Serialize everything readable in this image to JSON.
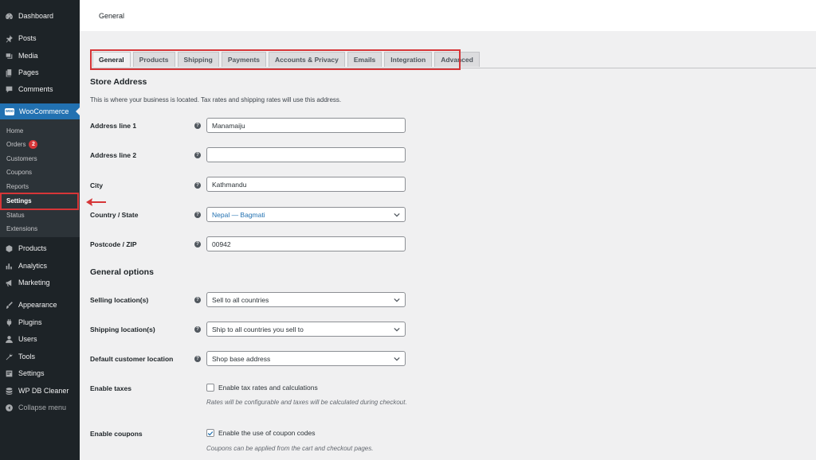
{
  "sidebar": {
    "dashboard": "Dashboard",
    "posts": "Posts",
    "media": "Media",
    "pages": "Pages",
    "comments": "Comments",
    "woocommerce": "WooCommerce",
    "woocommerce_logo": "woo",
    "submenu": {
      "home": "Home",
      "orders": "Orders",
      "orders_badge": "2",
      "customers": "Customers",
      "coupons": "Coupons",
      "reports": "Reports",
      "settings": "Settings",
      "status": "Status",
      "extensions": "Extensions"
    },
    "products": "Products",
    "analytics": "Analytics",
    "marketing": "Marketing",
    "appearance": "Appearance",
    "plugins": "Plugins",
    "users": "Users",
    "tools": "Tools",
    "settings": "Settings",
    "wp_db_cleaner": "WP DB Cleaner",
    "collapse": "Collapse menu"
  },
  "header": {
    "title": "General"
  },
  "tabs": [
    "General",
    "Products",
    "Shipping",
    "Payments",
    "Accounts & Privacy",
    "Emails",
    "Integration",
    "Advanced"
  ],
  "store_address": {
    "title": "Store Address",
    "description": "This is where your business is located. Tax rates and shipping rates will use this address.",
    "address1_label": "Address line 1",
    "address1_value": "Manamaiju",
    "address2_label": "Address line 2",
    "address2_value": "",
    "city_label": "City",
    "city_value": "Kathmandu",
    "country_label": "Country / State",
    "country_value": "Nepal — Bagmati",
    "postcode_label": "Postcode / ZIP",
    "postcode_value": "00942"
  },
  "general_options": {
    "title": "General options",
    "selling_label": "Selling location(s)",
    "selling_value": "Sell to all countries",
    "shipping_label": "Shipping location(s)",
    "shipping_value": "Ship to all countries you sell to",
    "default_customer_label": "Default customer location",
    "default_customer_value": "Shop base address",
    "taxes_label": "Enable taxes",
    "taxes_checkbox_label": "Enable tax rates and calculations",
    "taxes_checked": false,
    "taxes_hint": "Rates will be configurable and taxes will be calculated during checkout.",
    "coupons_label": "Enable coupons",
    "coupons_checkbox_label": "Enable the use of coupon codes",
    "coupons_checked": true,
    "coupons_hint": "Coupons can be applied from the cart and checkout pages."
  },
  "colors": {
    "sidebar_bg": "#1d2327",
    "accent": "#2271b1",
    "highlight_red": "#d63638",
    "badge": "#d63638"
  }
}
